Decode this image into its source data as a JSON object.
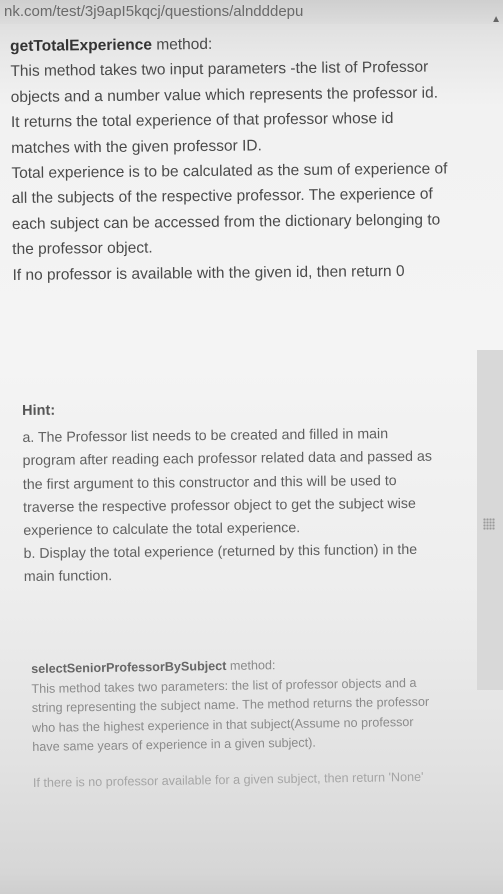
{
  "browser": {
    "url": "nk.com/test/3j9apI5kqcj/questions/alndddepu"
  },
  "section1": {
    "method_name": "getTotalExperience",
    "method_suffix": " method:",
    "paragraphs": [
      "This method takes two input parameters -the list of Professor objects and a number value which represents the professor id. It returns the total experience of that professor whose id matches with the given professor ID.",
      "Total experience is to be calculated as the sum of experience of all the subjects of the respective professor. The experience of each subject can be accessed from the dictionary belonging to the professor object.",
      "If no professor is available with the given id, then return 0"
    ]
  },
  "hint": {
    "title": "Hint:",
    "items": [
      "a. The Professor list needs to be created and filled in main program after reading each professor related data and passed as the first argument to this constructor and this will be used to traverse the respective professor object to get the subject wise experience to calculate the total experience.",
      "b. Display the total experience (returned by this function) in the main function."
    ]
  },
  "section3": {
    "method_name": "selectSeniorProfessorBySubject",
    "method_suffix": " method:",
    "paragraphs": [
      "This method takes two parameters: the list of professor objects and a string representing the subject name. The method returns the professor who has the highest experience in that subject(Assume no professor have same years of experience in a given subject).",
      "If there is no professor available for a given subject, then return 'None'"
    ]
  }
}
